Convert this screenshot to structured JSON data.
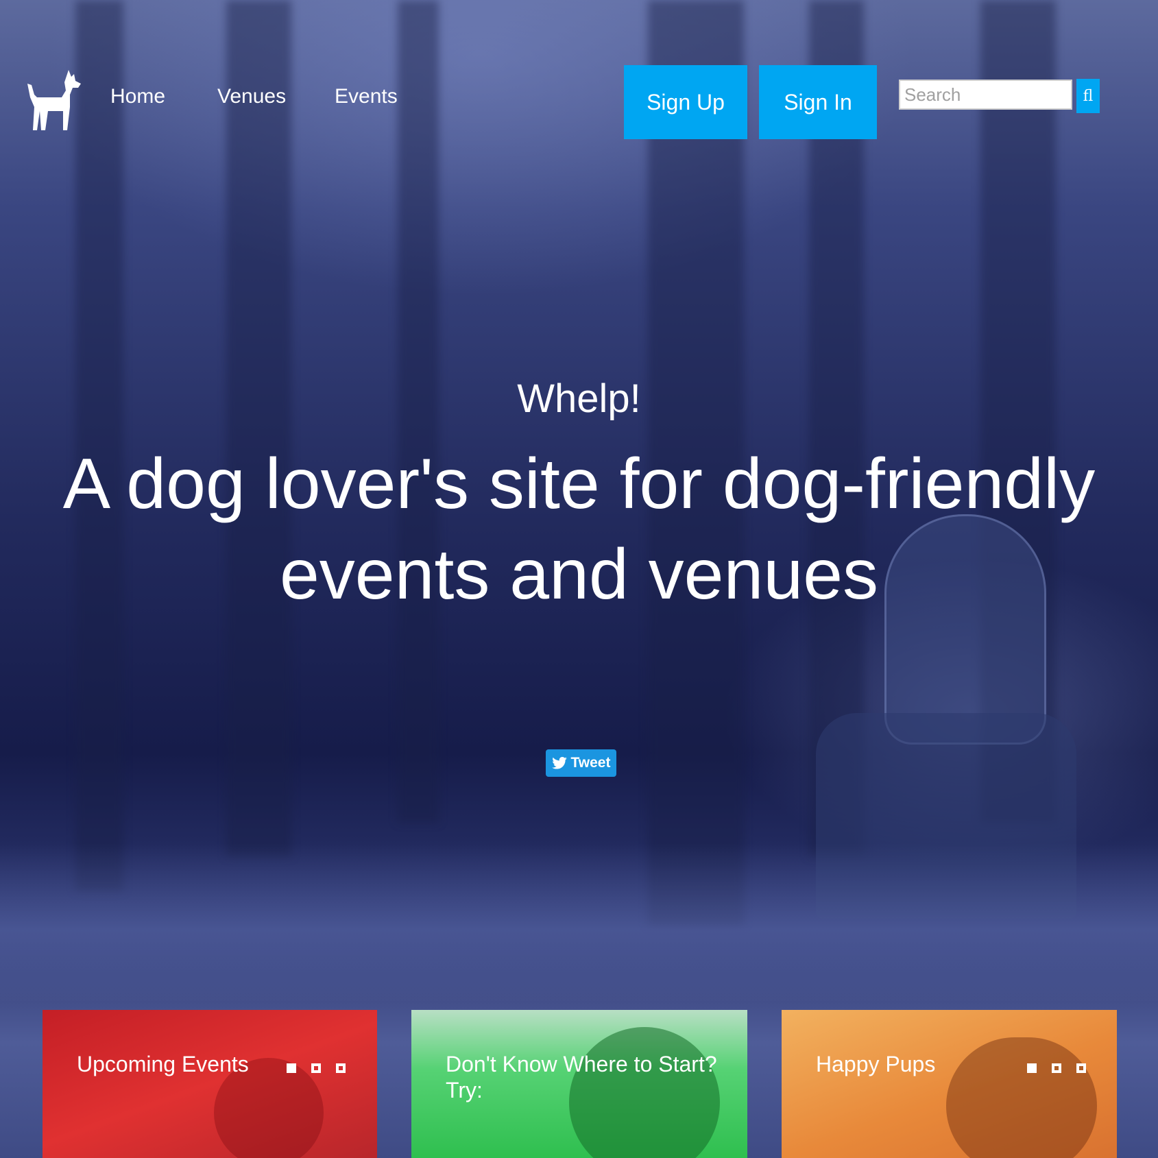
{
  "nav": {
    "logo_icon": "dog-icon",
    "links": [
      "Home",
      "Venues",
      "Events"
    ]
  },
  "auth": {
    "signup_label": "Sign Up",
    "signin_label": "Sign In"
  },
  "search": {
    "placeholder": "Search",
    "button_glyph": "fl"
  },
  "hero": {
    "brand": "Whelp!",
    "headline": "A dog lover's site for dog-friendly events and venues"
  },
  "tweet": {
    "label": "Tweet",
    "icon": "twitter-bird-icon"
  },
  "cards": [
    {
      "title": "Upcoming Events",
      "color": "#e03131"
    },
    {
      "title": "Don't Know Where to Start? Try:",
      "color": "#34c759"
    },
    {
      "title": "Happy Pups",
      "color": "#ef9b3c"
    }
  ],
  "colors": {
    "accent": "#00a6f2",
    "tweet": "#1b95e0"
  }
}
